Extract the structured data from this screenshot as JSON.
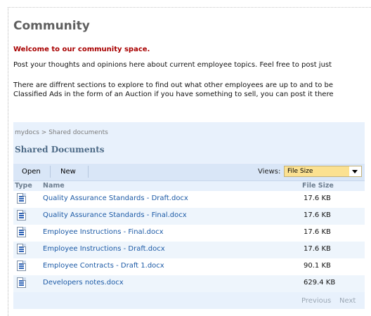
{
  "page": {
    "title": "Community",
    "welcome": "Welcome to our community space.",
    "paragraph1": "Post your thoughts and opinions here about current employee topics. Feel free to post just",
    "paragraph2_line1": "There are diffrent sections to explore to find out what other employees are up to and to be",
    "paragraph2_line2": "Classified Ads in the form of an Auction if you have something to sell, you can post it there"
  },
  "webpart": {
    "breadcrumb": "mydocs > Shared documents",
    "title": "Shared Documents",
    "toolbar": {
      "open_label": "Open",
      "new_label": "New",
      "views_label": "Views:",
      "views_selected": "File Size"
    },
    "columns": {
      "type": "Type",
      "name": "Name",
      "size": "File Size"
    },
    "documents": [
      {
        "name": "Quality Assurance Standards - Draft.docx",
        "size": "17.6 KB",
        "icon": "word-document-icon"
      },
      {
        "name": "Quality Assurance Standards - Final.docx",
        "size": "17.6 KB",
        "icon": "word-document-icon"
      },
      {
        "name": "Employee Instructions - Final.docx",
        "size": "17.6 KB",
        "icon": "word-document-icon"
      },
      {
        "name": "Employee Instructions - Draft.docx",
        "size": "17.6 KB",
        "icon": "word-document-icon"
      },
      {
        "name": "Employee Contracts - Draft 1.docx",
        "size": "90.1 KB",
        "icon": "word-document-icon"
      },
      {
        "name": "Developers notes.docx",
        "size": "629.4 KB",
        "icon": "word-document-icon"
      }
    ],
    "pager": {
      "previous": "Previous",
      "next": "Next"
    }
  }
}
